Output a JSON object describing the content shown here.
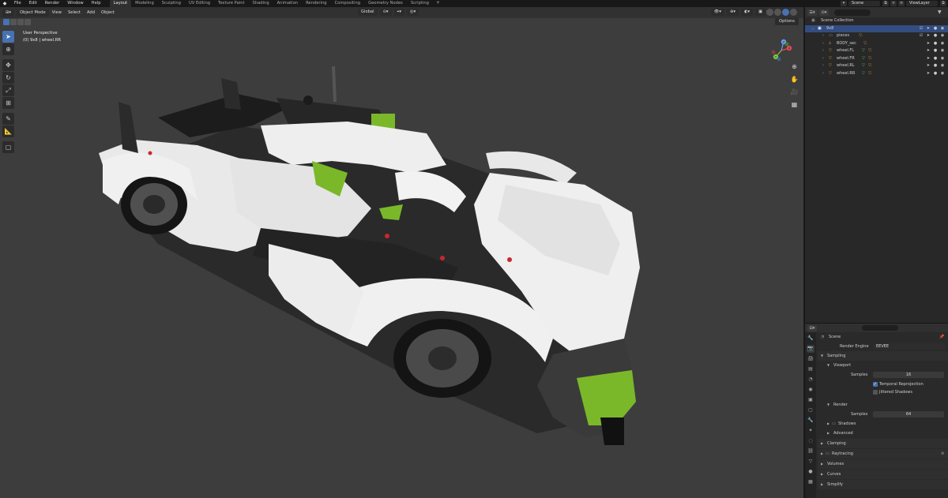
{
  "menubar": {
    "logo": "blender-logo-icon",
    "menus": [
      "File",
      "Edit",
      "Render",
      "Window",
      "Help"
    ],
    "workspaces": [
      "Layout",
      "Modeling",
      "Sculpting",
      "UV Editing",
      "Texture Paint",
      "Shading",
      "Animation",
      "Rendering",
      "Compositing",
      "Geometry Nodes",
      "Scripting"
    ],
    "active_workspace": "Layout",
    "add_workspace": "+",
    "scene_name": "Scene",
    "view_layer": "ViewLayer"
  },
  "viewport": {
    "mode": "Object Mode",
    "menus": [
      "View",
      "Select",
      "Add",
      "Object"
    ],
    "transform_orientation": "Global",
    "options": "Options",
    "info_line1": "User Perspective",
    "info_line2": "(0) 9x8 | wheel.RR",
    "gizmo_axes": [
      "X",
      "Y",
      "Z"
    ]
  },
  "outliner": {
    "search_placeholder": "",
    "rows": [
      {
        "label": "Scene Collection",
        "indent": 0
      },
      {
        "label": "9x8",
        "indent": 1,
        "selected": true
      },
      {
        "label": "pieces",
        "indent": 2
      },
      {
        "label": "BODY_sec",
        "indent": 2
      },
      {
        "label": "wheel.FL",
        "indent": 2
      },
      {
        "label": "wheel.FR",
        "indent": 2
      },
      {
        "label": "wheel.RL",
        "indent": 2
      },
      {
        "label": "wheel.RR",
        "indent": 2
      }
    ]
  },
  "properties": {
    "search_placeholder": "",
    "breadcrumb": "Scene",
    "render_engine_label": "Render Engine",
    "render_engine": "EEVEE",
    "sampling": "Sampling",
    "viewport": "Viewport",
    "samples_label": "Samples",
    "viewport_samples": "16",
    "temporal_reprojection": "Temporal Reprojection",
    "jittered_shadows": "Jittered Shadows",
    "render": "Render",
    "render_samples": "64",
    "shadows": "Shadows",
    "advanced": "Advanced",
    "clamping": "Clamping",
    "raytracing": "Raytracing",
    "volumes": "Volumes",
    "curves": "Curves",
    "simplify": "Simplify"
  }
}
